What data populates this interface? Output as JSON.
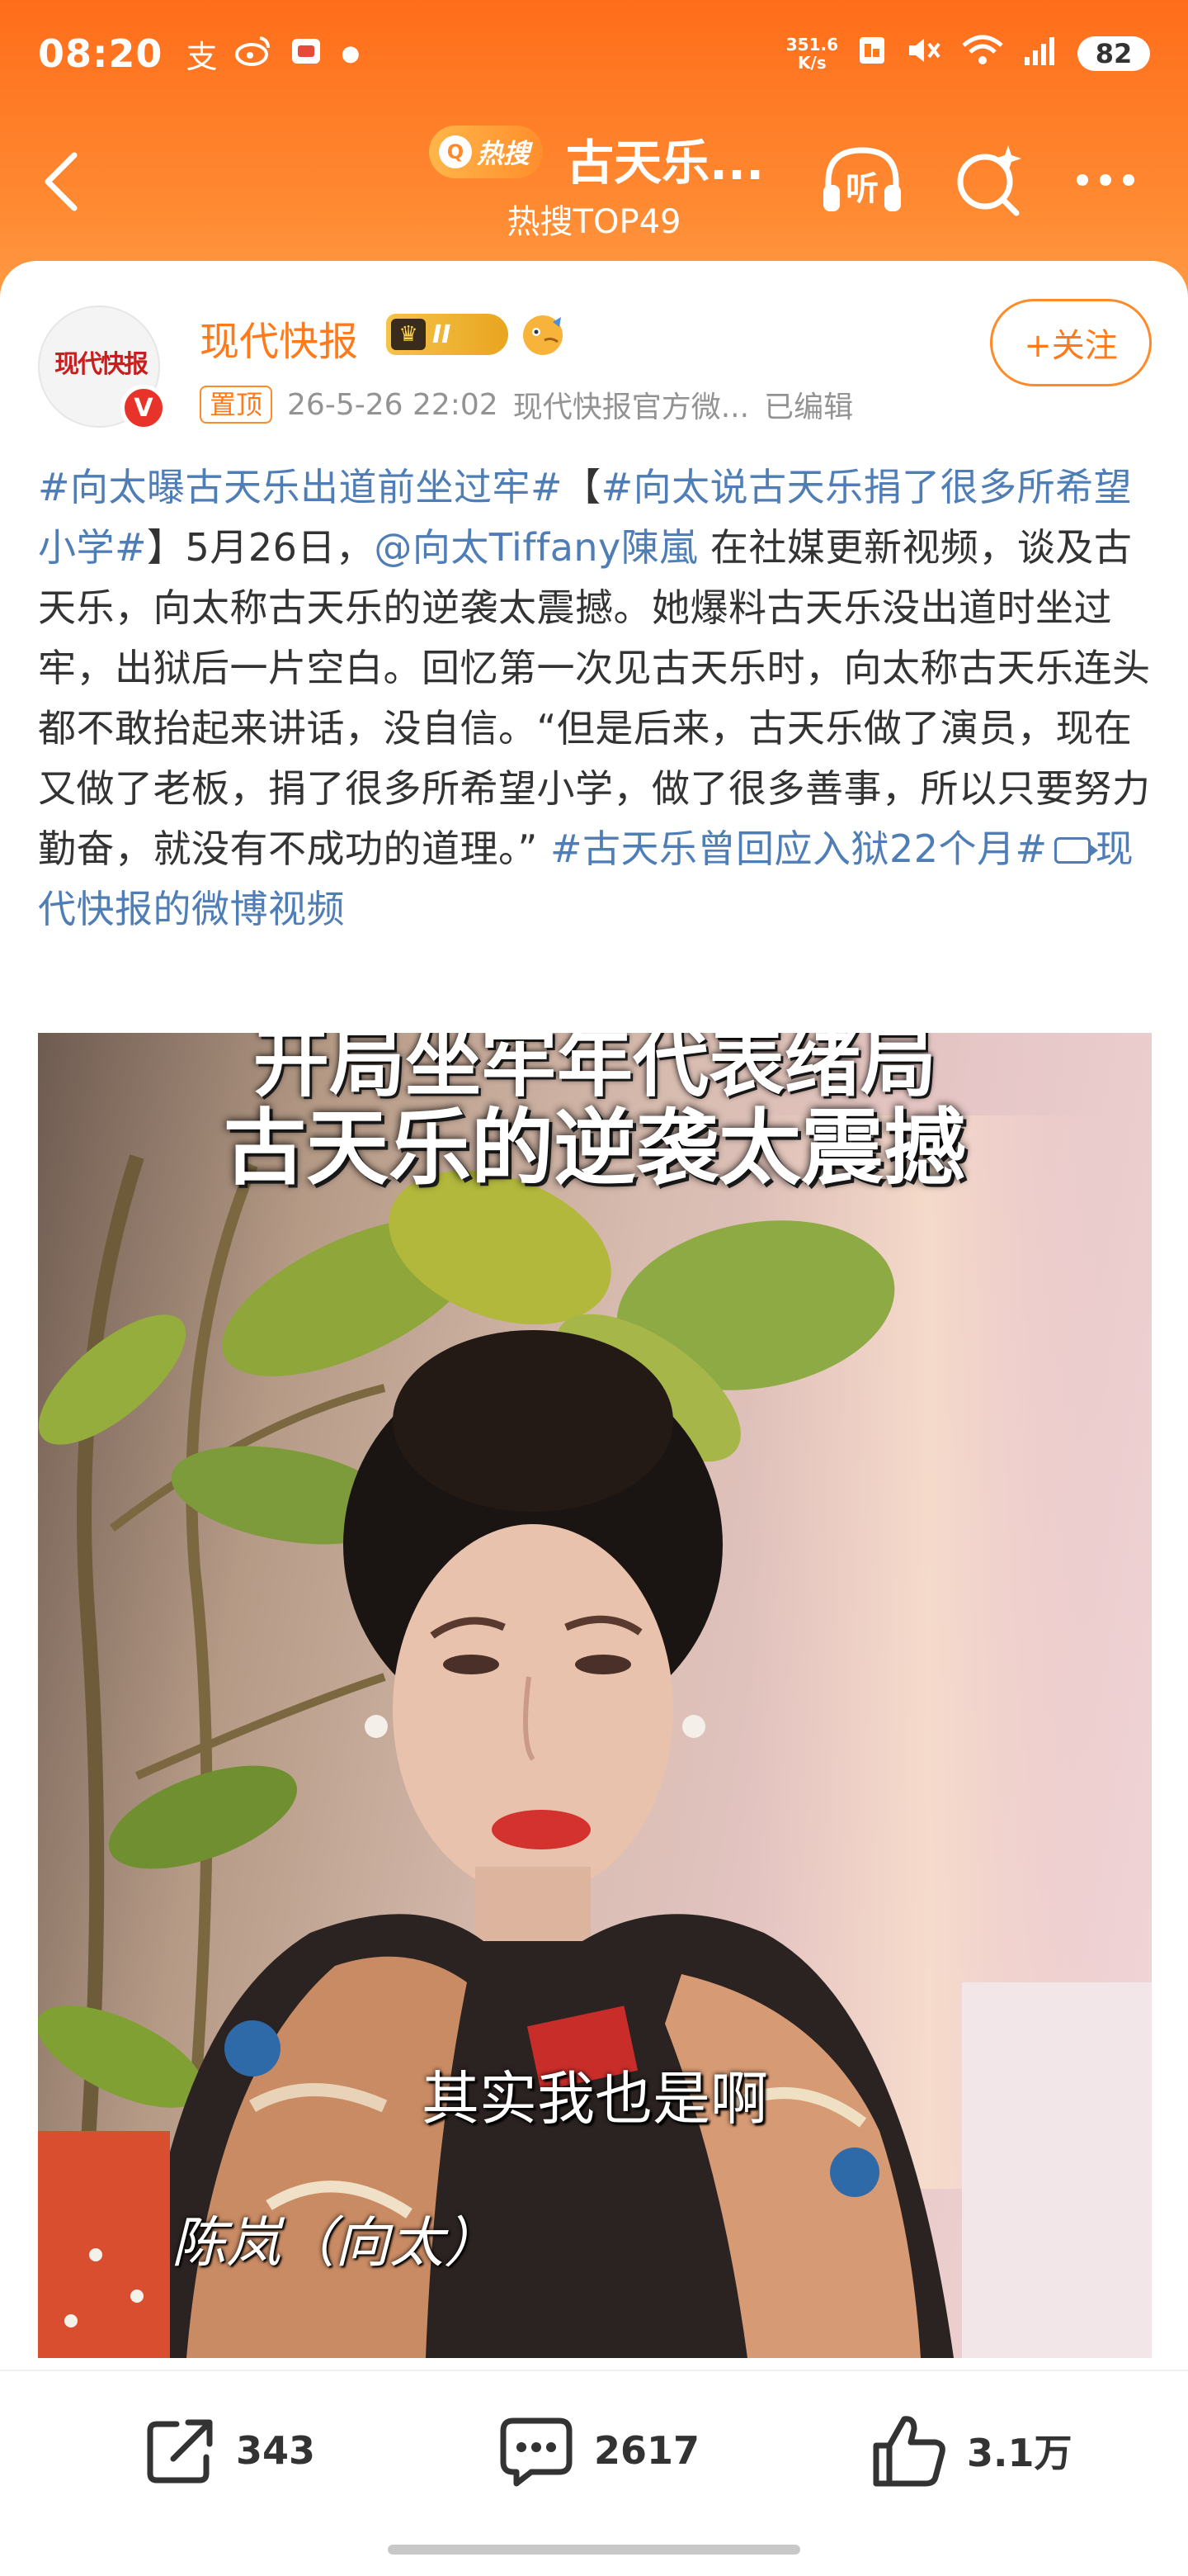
{
  "status_bar": {
    "time": "08:20",
    "left_icons": [
      "alipay-icon",
      "weibo-icon",
      "app-icon",
      "dot-icon"
    ],
    "net_speed_value": "351.6",
    "net_speed_unit": "K/s",
    "battery": "82"
  },
  "nav": {
    "hot_pill": "热搜",
    "title": "古天乐...",
    "subtitle": "热搜TOP49"
  },
  "post": {
    "author": "现代快报",
    "avatar_text": "现代快报",
    "verified_mark": "V",
    "badge_level": "II",
    "follow_label": "+关注",
    "pin_tag": "置顶",
    "time": "26-5-26 22:02",
    "source": "现代快报官方微...",
    "edited": "已编辑",
    "text": {
      "hashtag1": "#向太曝古天乐出道前坐过牢#",
      "bracket_open": "【",
      "hashtag2": "#向太说古天乐捐了很多所希望小学#",
      "part1": "】5月26日，",
      "mention": "@向太Tiffany陳嵐",
      "part2": " 在社媒更新视频，谈及古天乐，向太称古天乐的逆袭太震撼。她爆料古天乐没出道时坐过牢，出狱后一片空白。回忆第一次见古天乐时，向太称古天乐连头都不敢抬起来讲话，没自信。“但是后来，古天乐做了演员，现在又做了老板，捐了很多所希望小学，做了很多善事，所以只要努力勤奋，就没有不成功的道理。” ",
      "hashtag3": "#古天乐曾回应入狱22个月#",
      "video_link": "现代快报的微博视频"
    }
  },
  "video": {
    "title_top_partial": "开局坐牢年代表绪局",
    "title_main": "古天乐的逆袭太震撼",
    "caption": "其实我也是啊",
    "name_tag": "陈岚（向太）"
  },
  "actions": {
    "share_count": "343",
    "comment_count": "2617",
    "like_count": "3.1万"
  },
  "colors": {
    "header_orange": "#ff7a1a",
    "link_blue": "#4f7db5",
    "author_orange": "#ff7a1a"
  }
}
